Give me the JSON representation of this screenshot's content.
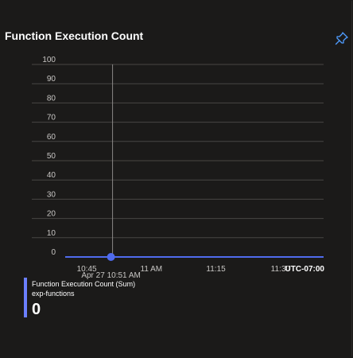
{
  "tile": {
    "title": "Function Execution Count",
    "pin_icon": "pin-icon"
  },
  "colors": {
    "background": "#1b1a19",
    "series": "#4f6bed",
    "grid": "#484644",
    "cursor": "#8a8886"
  },
  "chart_data": {
    "type": "line",
    "title": "Function Execution Count",
    "xlabel": "",
    "ylabel": "",
    "ylim": [
      0,
      100
    ],
    "y_ticks": [
      0,
      10,
      20,
      30,
      40,
      50,
      60,
      70,
      80,
      90,
      100
    ],
    "x_ticks": [
      "10:45",
      "11 AM",
      "11:15",
      "11:30"
    ],
    "x_range": [
      "10:40",
      "11:40"
    ],
    "timezone_label": "UTC-07:00",
    "grid": true,
    "series": [
      {
        "name": "Function Execution Count (Sum)",
        "x": [
          "10:40",
          "10:45",
          "10:50",
          "10:55",
          "11:00",
          "11:05",
          "11:10",
          "11:15",
          "11:20",
          "11:25",
          "11:30",
          "11:35",
          "11:40"
        ],
        "values": [
          0,
          0,
          0,
          0,
          0,
          0,
          0,
          0,
          0,
          0,
          0,
          0,
          0
        ]
      }
    ],
    "hover": {
      "label": "Apr 27 10:51 AM",
      "time": "10:51",
      "value": 0
    }
  },
  "legend": {
    "metric": "Function Execution Count (Sum)",
    "resource": "exp-functions",
    "value": "0"
  }
}
